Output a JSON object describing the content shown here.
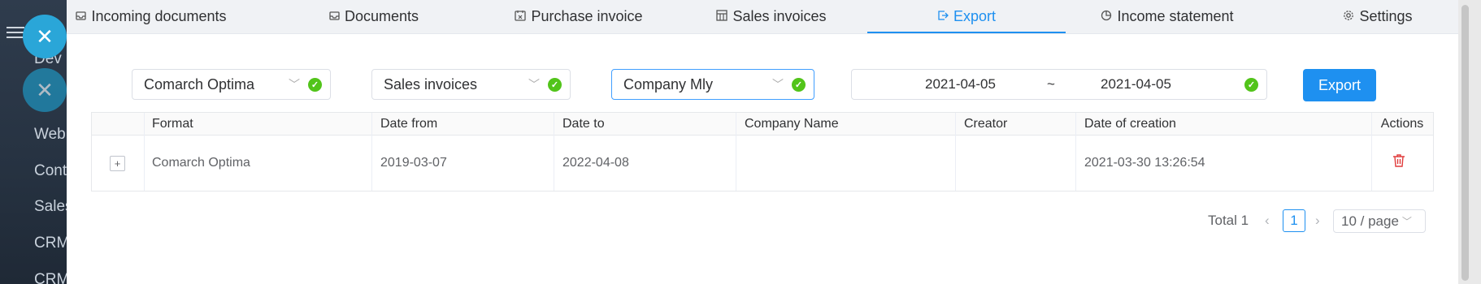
{
  "background": {
    "sidebar_items": [
      "Dev",
      "Web",
      "Cont",
      "Sales",
      "CRM",
      "CRM"
    ]
  },
  "tabs": [
    {
      "label": "Incoming documents",
      "icon": "inbox-icon"
    },
    {
      "label": "Documents",
      "icon": "inbox-icon"
    },
    {
      "label": "Purchase invoice",
      "icon": "calendar-x-icon"
    },
    {
      "label": "Sales invoices",
      "icon": "grid-icon"
    },
    {
      "label": "Export",
      "icon": "export-icon",
      "active": true
    },
    {
      "label": "Income statement",
      "icon": "pie-chart-icon"
    },
    {
      "label": "Settings",
      "icon": "gear-icon"
    }
  ],
  "filters": {
    "format": "Comarch Optima",
    "type": "Sales invoices",
    "company": "Company Mly",
    "date_from": "2021-04-05",
    "date_sep": "~",
    "date_to": "2021-04-05",
    "export_label": "Export"
  },
  "table": {
    "columns": [
      "Format",
      "Date from",
      "Date to",
      "Company Name",
      "Creator",
      "Date of creation",
      "Actions"
    ],
    "rows": [
      {
        "expand": "+",
        "format": "Comarch Optima",
        "date_from": "2019-03-07",
        "date_to": "2022-04-08",
        "company": "",
        "creator": "",
        "created": "2021-03-30 13:26:54"
      }
    ]
  },
  "pagination": {
    "total_label": "Total 1",
    "current_page": "1",
    "page_size": "10 / page"
  },
  "colors": {
    "accent": "#1e90f0",
    "success": "#52c41a",
    "danger": "#e03b3b"
  }
}
